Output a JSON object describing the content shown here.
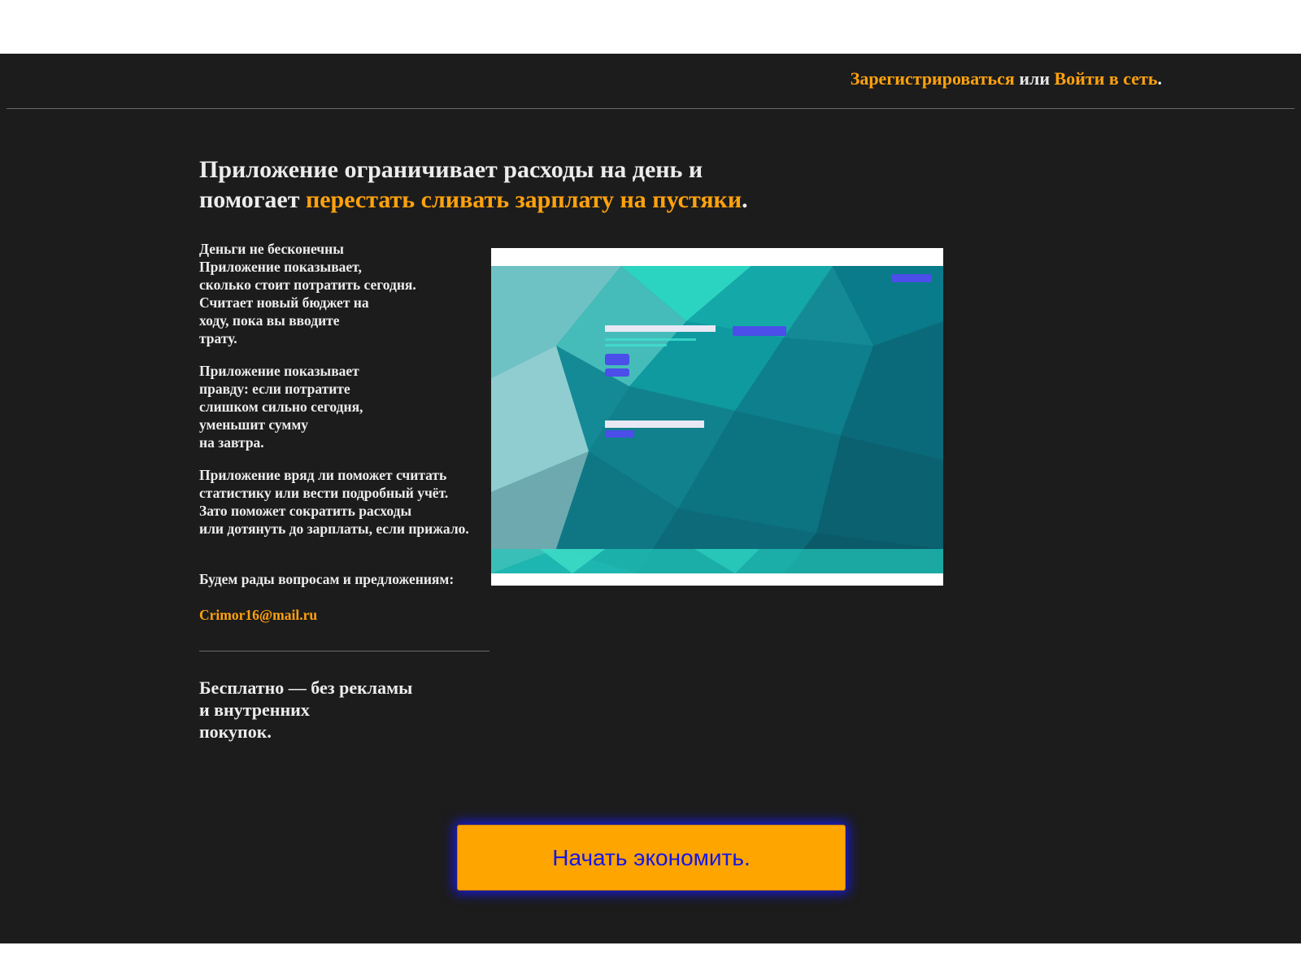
{
  "header": {
    "register_link": "Зарегистрироваться",
    "or_text": "или",
    "login_link": "Войти в сеть",
    "end_dot": "."
  },
  "headline": {
    "line1": "Приложение ограничивает расходы на день и",
    "line2_plain": "помогает ",
    "line2_accent": "перестать сливать зарплату на пустяки",
    "line2_end": "."
  },
  "features": {
    "p1": "Деньги не бесконечны\nПриложение показывает,\nсколько стоит потратить сегодня.\nСчитает новый бюджет на\nходу, пока вы вводите\nтрату.",
    "p2": "Приложение показывает\nправду: если потратите\nслишком сильно сегодня,\nуменьшит сумму\nна завтра.",
    "p3": "Приложение вряд ли поможет считать\nстатистику или вести подробный учёт.\nЗато поможет сократить расходы\nили дотянуть до зарплаты, если прижало.",
    "contact_text": "Будем рады вопросам и предложениям:",
    "email": "Crimor16@mail.ru"
  },
  "free_note": "Бесплатно — без рекламы\nи внутренних\nпокупок.",
  "cta_label": "Начать экономить.",
  "colors": {
    "accent": "#ffa20e",
    "background": "#1c1c1c",
    "cta_bg": "#ffa500",
    "cta_text": "#1616e6"
  }
}
